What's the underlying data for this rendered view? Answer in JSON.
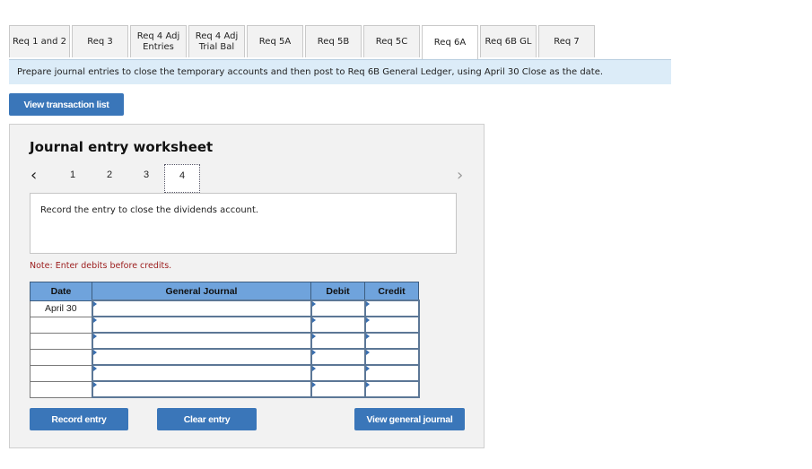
{
  "tabs": [
    {
      "label": "Req 1 and 2",
      "active": false
    },
    {
      "label": "Req 3",
      "active": false
    },
    {
      "label": "Req 4 Adj Entries",
      "line1": "Req 4 Adj",
      "line2": "Entries",
      "active": false
    },
    {
      "label": "Req 4 Adj Trial Bal",
      "line1": "Req 4 Adj",
      "line2": "Trial Bal",
      "active": false
    },
    {
      "label": "Req 5A",
      "active": false
    },
    {
      "label": "Req 5B",
      "active": false
    },
    {
      "label": "Req 5C",
      "active": false
    },
    {
      "label": "Req 6A",
      "active": true
    },
    {
      "label": "Req 6B GL",
      "active": false
    },
    {
      "label": "Req 7",
      "active": false
    }
  ],
  "instructions": "Prepare journal entries to close the temporary accounts and then post to Req 6B General Ledger, using April 30 Close as the date.",
  "buttons": {
    "view_transaction_list": "View transaction list",
    "record_entry": "Record entry",
    "clear_entry": "Clear entry",
    "view_general_journal": "View general journal"
  },
  "worksheet": {
    "title": "Journal entry worksheet",
    "pages": [
      "1",
      "2",
      "3",
      "4"
    ],
    "current_page": "4",
    "prev_icon": "chevron-left-icon",
    "next_icon": "chevron-right-icon",
    "description": "Record the entry to close the dividends account.",
    "note": "Note: Enter debits before credits."
  },
  "journal": {
    "headers": {
      "date": "Date",
      "general_journal": "General Journal",
      "debit": "Debit",
      "credit": "Credit"
    },
    "rows": [
      {
        "date": "April 30",
        "account": "",
        "debit": "",
        "credit": ""
      },
      {
        "date": "",
        "account": "",
        "debit": "",
        "credit": ""
      },
      {
        "date": "",
        "account": "",
        "debit": "",
        "credit": ""
      },
      {
        "date": "",
        "account": "",
        "debit": "",
        "credit": ""
      },
      {
        "date": "",
        "account": "",
        "debit": "",
        "credit": ""
      },
      {
        "date": "",
        "account": "",
        "debit": "",
        "credit": ""
      }
    ]
  }
}
